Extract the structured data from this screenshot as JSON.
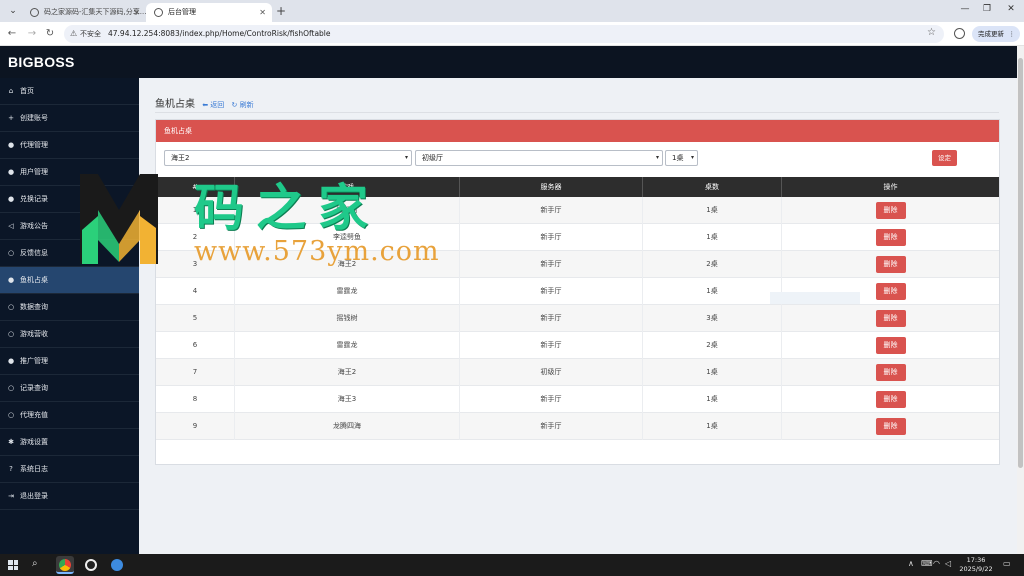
{
  "browser": {
    "tabs": [
      {
        "label": "码之家源码-汇集天下源码,分享..."
      },
      {
        "label": "后台管理"
      }
    ],
    "address": {
      "insecure_label": "不安全",
      "url": "47.94.12.254:8083/index.php/Home/ControRisk/fishOftable"
    },
    "update_label": "完成更新"
  },
  "app": {
    "brand": "BIGBOSS"
  },
  "sidebar": {
    "items": [
      {
        "label": "首页",
        "icon": "home-icon"
      },
      {
        "label": "创建账号",
        "icon": "plus-icon"
      },
      {
        "label": "代理管理",
        "icon": "user-icon"
      },
      {
        "label": "用户管理",
        "icon": "user-icon"
      },
      {
        "label": "兑换记录",
        "icon": "user-icon"
      },
      {
        "label": "游戏公告",
        "icon": "volume-icon"
      },
      {
        "label": "反馈信息",
        "icon": "search-icon"
      },
      {
        "label": "鱼机占桌",
        "icon": "info-circle-icon",
        "active": true
      },
      {
        "label": "数据查询",
        "icon": "search-icon"
      },
      {
        "label": "游戏营收",
        "icon": "search-icon"
      },
      {
        "label": "推广管理",
        "icon": "user-icon"
      },
      {
        "label": "记录查询",
        "icon": "search-icon"
      },
      {
        "label": "代理充值",
        "icon": "search-icon"
      },
      {
        "label": "游戏设置",
        "icon": "gear-icon"
      },
      {
        "label": "系统日志",
        "icon": "question-circle-icon"
      },
      {
        "label": "退出登录",
        "icon": "logout-icon"
      }
    ]
  },
  "page": {
    "title": "鱼机占桌",
    "back_label": "返回",
    "refresh_label": "刷新",
    "panel_title": "鱼机占桌"
  },
  "filters": {
    "game_value": "海王2",
    "server_value": "初级厅",
    "table_value": "1桌",
    "set_label": "设定"
  },
  "table": {
    "columns": [
      "#",
      "游戏",
      "服务器",
      "桌数",
      "操作"
    ],
    "delete_label": "删除",
    "rows": [
      {
        "id": "1",
        "game": "摇钱树",
        "server": "新手厅",
        "table": "1桌"
      },
      {
        "id": "2",
        "game": "李逵劈鱼",
        "server": "新手厅",
        "table": "1桌"
      },
      {
        "id": "3",
        "game": "海王2",
        "server": "新手厅",
        "table": "2桌"
      },
      {
        "id": "4",
        "game": "雷霆龙",
        "server": "新手厅",
        "table": "1桌"
      },
      {
        "id": "5",
        "game": "摇钱树",
        "server": "新手厅",
        "table": "3桌"
      },
      {
        "id": "6",
        "game": "雷霆龙",
        "server": "新手厅",
        "table": "2桌"
      },
      {
        "id": "7",
        "game": "海王2",
        "server": "初级厅",
        "table": "1桌"
      },
      {
        "id": "8",
        "game": "海王3",
        "server": "新手厅",
        "table": "1桌"
      },
      {
        "id": "9",
        "game": "龙腾四海",
        "server": "新手厅",
        "table": "1桌"
      }
    ]
  },
  "watermark": {
    "title": "码之家",
    "url": "www.573ym.com"
  },
  "taskbar": {
    "time": "17:36",
    "date": "2025/9/22"
  },
  "colors": {
    "brand_dark": "#0c1421",
    "sidebar_bg": "#0b1627",
    "sidebar_active": "#25466f",
    "danger": "#d9534f",
    "table_head": "#2d2d2d"
  }
}
